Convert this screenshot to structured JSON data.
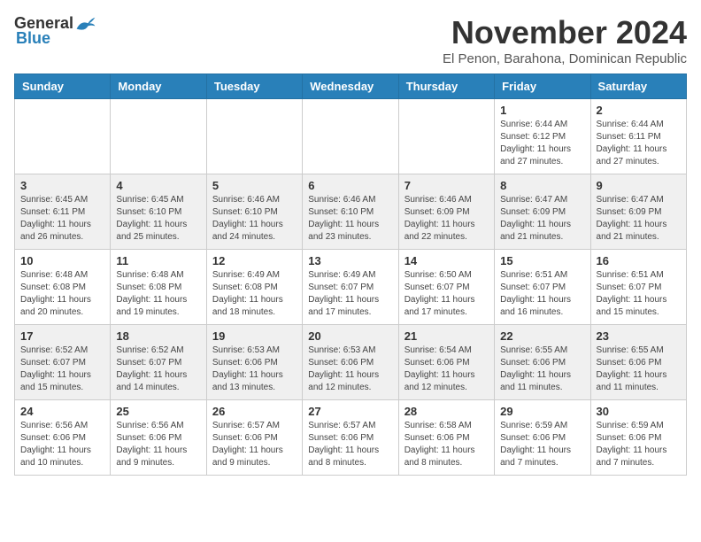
{
  "header": {
    "logo_general": "General",
    "logo_blue": "Blue",
    "month_title": "November 2024",
    "subtitle": "El Penon, Barahona, Dominican Republic"
  },
  "days_of_week": [
    "Sunday",
    "Monday",
    "Tuesday",
    "Wednesday",
    "Thursday",
    "Friday",
    "Saturday"
  ],
  "weeks": [
    [
      {
        "day": "",
        "info": ""
      },
      {
        "day": "",
        "info": ""
      },
      {
        "day": "",
        "info": ""
      },
      {
        "day": "",
        "info": ""
      },
      {
        "day": "",
        "info": ""
      },
      {
        "day": "1",
        "info": "Sunrise: 6:44 AM\nSunset: 6:12 PM\nDaylight: 11 hours and 27 minutes."
      },
      {
        "day": "2",
        "info": "Sunrise: 6:44 AM\nSunset: 6:11 PM\nDaylight: 11 hours and 27 minutes."
      }
    ],
    [
      {
        "day": "3",
        "info": "Sunrise: 6:45 AM\nSunset: 6:11 PM\nDaylight: 11 hours and 26 minutes."
      },
      {
        "day": "4",
        "info": "Sunrise: 6:45 AM\nSunset: 6:10 PM\nDaylight: 11 hours and 25 minutes."
      },
      {
        "day": "5",
        "info": "Sunrise: 6:46 AM\nSunset: 6:10 PM\nDaylight: 11 hours and 24 minutes."
      },
      {
        "day": "6",
        "info": "Sunrise: 6:46 AM\nSunset: 6:10 PM\nDaylight: 11 hours and 23 minutes."
      },
      {
        "day": "7",
        "info": "Sunrise: 6:46 AM\nSunset: 6:09 PM\nDaylight: 11 hours and 22 minutes."
      },
      {
        "day": "8",
        "info": "Sunrise: 6:47 AM\nSunset: 6:09 PM\nDaylight: 11 hours and 21 minutes."
      },
      {
        "day": "9",
        "info": "Sunrise: 6:47 AM\nSunset: 6:09 PM\nDaylight: 11 hours and 21 minutes."
      }
    ],
    [
      {
        "day": "10",
        "info": "Sunrise: 6:48 AM\nSunset: 6:08 PM\nDaylight: 11 hours and 20 minutes."
      },
      {
        "day": "11",
        "info": "Sunrise: 6:48 AM\nSunset: 6:08 PM\nDaylight: 11 hours and 19 minutes."
      },
      {
        "day": "12",
        "info": "Sunrise: 6:49 AM\nSunset: 6:08 PM\nDaylight: 11 hours and 18 minutes."
      },
      {
        "day": "13",
        "info": "Sunrise: 6:49 AM\nSunset: 6:07 PM\nDaylight: 11 hours and 17 minutes."
      },
      {
        "day": "14",
        "info": "Sunrise: 6:50 AM\nSunset: 6:07 PM\nDaylight: 11 hours and 17 minutes."
      },
      {
        "day": "15",
        "info": "Sunrise: 6:51 AM\nSunset: 6:07 PM\nDaylight: 11 hours and 16 minutes."
      },
      {
        "day": "16",
        "info": "Sunrise: 6:51 AM\nSunset: 6:07 PM\nDaylight: 11 hours and 15 minutes."
      }
    ],
    [
      {
        "day": "17",
        "info": "Sunrise: 6:52 AM\nSunset: 6:07 PM\nDaylight: 11 hours and 15 minutes."
      },
      {
        "day": "18",
        "info": "Sunrise: 6:52 AM\nSunset: 6:07 PM\nDaylight: 11 hours and 14 minutes."
      },
      {
        "day": "19",
        "info": "Sunrise: 6:53 AM\nSunset: 6:06 PM\nDaylight: 11 hours and 13 minutes."
      },
      {
        "day": "20",
        "info": "Sunrise: 6:53 AM\nSunset: 6:06 PM\nDaylight: 11 hours and 12 minutes."
      },
      {
        "day": "21",
        "info": "Sunrise: 6:54 AM\nSunset: 6:06 PM\nDaylight: 11 hours and 12 minutes."
      },
      {
        "day": "22",
        "info": "Sunrise: 6:55 AM\nSunset: 6:06 PM\nDaylight: 11 hours and 11 minutes."
      },
      {
        "day": "23",
        "info": "Sunrise: 6:55 AM\nSunset: 6:06 PM\nDaylight: 11 hours and 11 minutes."
      }
    ],
    [
      {
        "day": "24",
        "info": "Sunrise: 6:56 AM\nSunset: 6:06 PM\nDaylight: 11 hours and 10 minutes."
      },
      {
        "day": "25",
        "info": "Sunrise: 6:56 AM\nSunset: 6:06 PM\nDaylight: 11 hours and 9 minutes."
      },
      {
        "day": "26",
        "info": "Sunrise: 6:57 AM\nSunset: 6:06 PM\nDaylight: 11 hours and 9 minutes."
      },
      {
        "day": "27",
        "info": "Sunrise: 6:57 AM\nSunset: 6:06 PM\nDaylight: 11 hours and 8 minutes."
      },
      {
        "day": "28",
        "info": "Sunrise: 6:58 AM\nSunset: 6:06 PM\nDaylight: 11 hours and 8 minutes."
      },
      {
        "day": "29",
        "info": "Sunrise: 6:59 AM\nSunset: 6:06 PM\nDaylight: 11 hours and 7 minutes."
      },
      {
        "day": "30",
        "info": "Sunrise: 6:59 AM\nSunset: 6:06 PM\nDaylight: 11 hours and 7 minutes."
      }
    ]
  ]
}
